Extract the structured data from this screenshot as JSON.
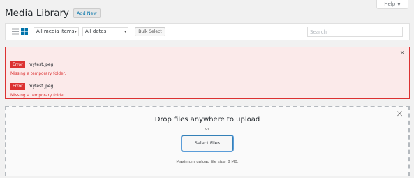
{
  "help": {
    "label": "Help",
    "caret": "▼"
  },
  "header": {
    "title": "Media Library",
    "add_new": "Add New"
  },
  "toolbar": {
    "filter_type": "All media items",
    "filter_date": "All dates",
    "bulk_select": "Bulk Select",
    "search_placeholder": "Search"
  },
  "errors": {
    "items": [
      {
        "label": "Error",
        "filename": "mytest.jpeg",
        "message": "Missing a temporary folder."
      },
      {
        "label": "Error",
        "filename": "mytest.jpeg",
        "message": "Missing a temporary folder."
      }
    ],
    "close": "×"
  },
  "uploader": {
    "heading": "Drop files anywhere to upload",
    "or": "or",
    "select_files": "Select Files",
    "max_size": "Maximum upload file size: 8 MB.",
    "close": "×"
  },
  "colors": {
    "accent": "#0073aa",
    "error": "#dc3232",
    "error_bg": "#fbeaea"
  }
}
